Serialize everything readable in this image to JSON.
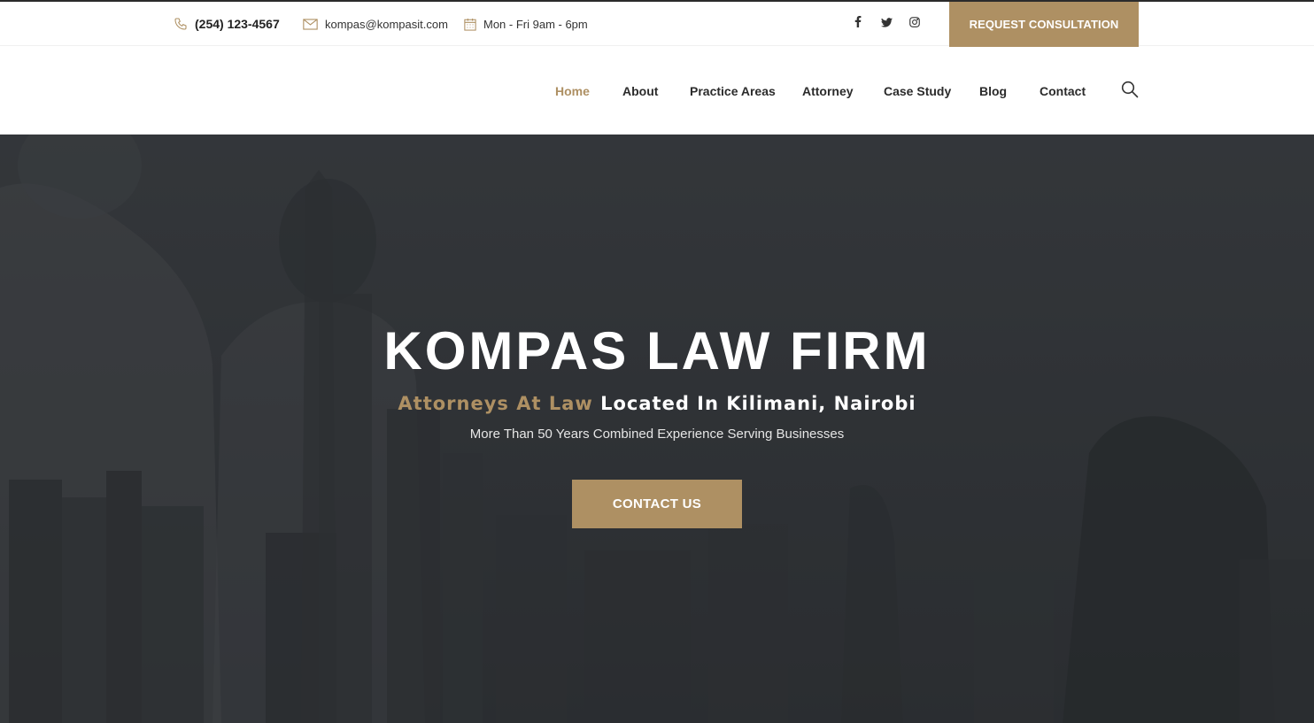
{
  "colors": {
    "accent": "#ae9063",
    "hero_bg": "#35383c",
    "text_dark": "#2b2b2b"
  },
  "topbar": {
    "phone": {
      "icon": "phone-icon",
      "text": "(254) 123-4567"
    },
    "email": {
      "icon": "envelope-icon",
      "text": "kompas@kompasit.com"
    },
    "hours": {
      "icon": "calendar-icon",
      "text": "Mon - Fri 9am - 6pm"
    },
    "social": [
      {
        "icon": "facebook-icon"
      },
      {
        "icon": "twitter-icon"
      },
      {
        "icon": "instagram-icon"
      }
    ],
    "cta_label": "REQUEST CONSULTATION"
  },
  "nav": {
    "items": [
      {
        "label": "Home",
        "active": true
      },
      {
        "label": "About"
      },
      {
        "label": "Practice Areas"
      },
      {
        "label": "Attorney"
      },
      {
        "label": "Case Study"
      },
      {
        "label": "Blog"
      },
      {
        "label": "Contact"
      }
    ],
    "search_icon": "search-icon"
  },
  "hero": {
    "title": "KOMPAS LAW FIRM",
    "subtitle_accent": "Attorneys At Law",
    "subtitle_rest": "Located In Kilimani, Nairobi",
    "description": "More Than 50 Years Combined Experience Serving Businesses",
    "button_label": "CONTACT US"
  }
}
